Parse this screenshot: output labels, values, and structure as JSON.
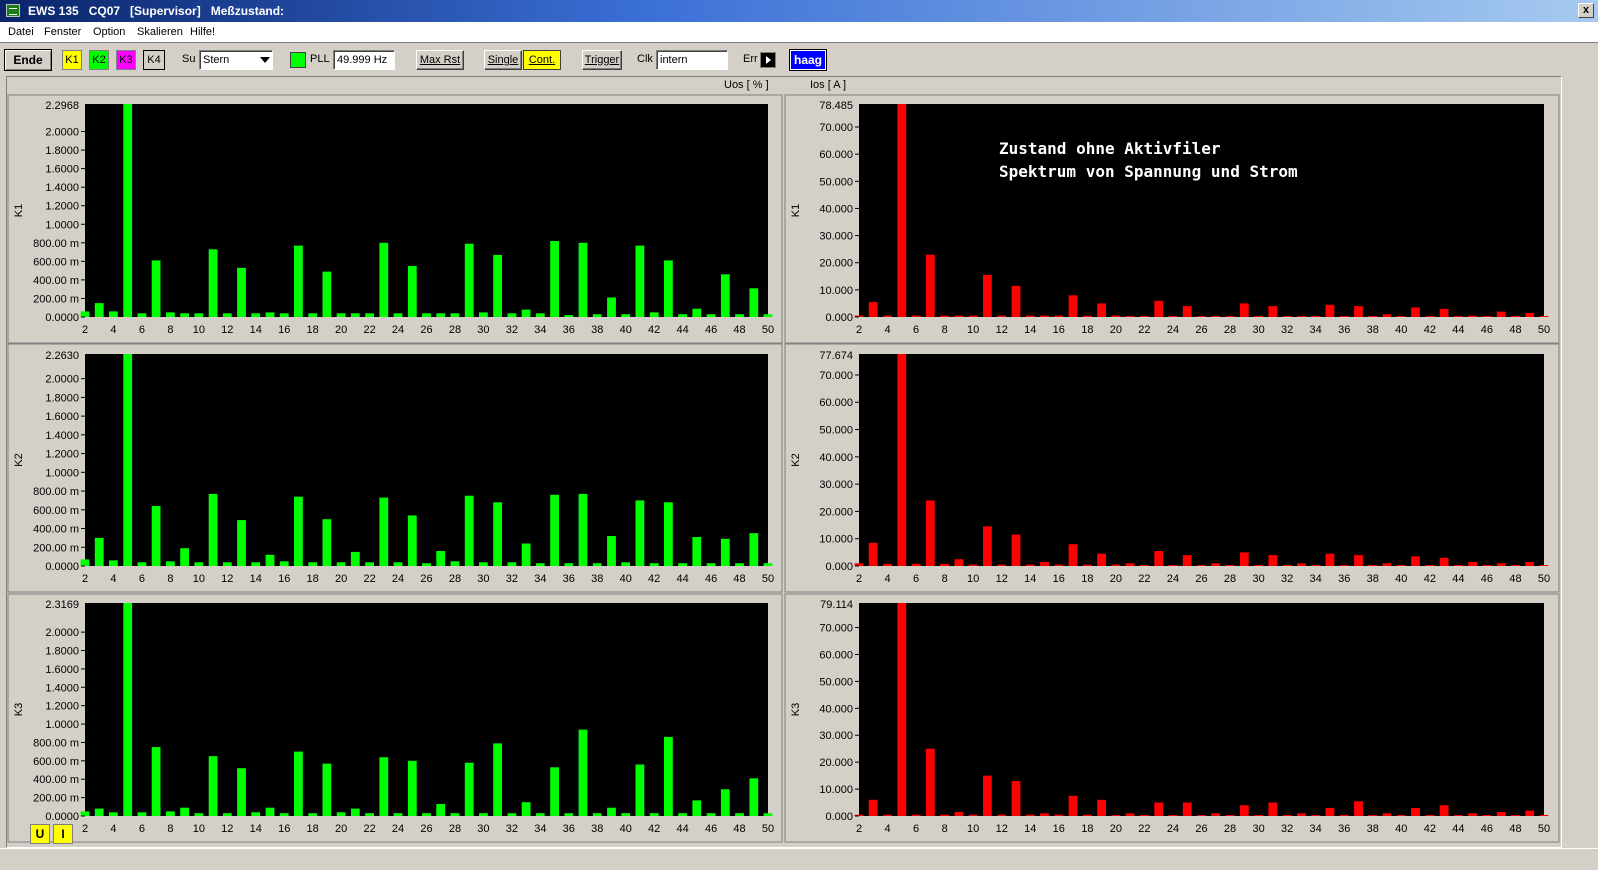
{
  "window": {
    "title": "EWS 135   CQ07   [Supervisor]   Meßzustand:",
    "close_label": "x"
  },
  "menu": [
    "Datei",
    "Fenster",
    "Option",
    "Skalieren",
    "Hilfe!"
  ],
  "toolbar": {
    "ende": "Ende",
    "k1": "K1",
    "k2": "K2",
    "k3": "K3",
    "k4": "K4",
    "su_label": "Su",
    "su_value": "Stern",
    "pll_label": "PLL",
    "pll_value": "49.999 Hz",
    "maxrst": "Max Rst",
    "single": "Single",
    "cont": "Cont.",
    "trigger": "Trigger",
    "clk_label": "Clk",
    "clk_value": "intern",
    "err_label": "Err",
    "logo": "haag"
  },
  "headers": {
    "left": "Uos [ % ]",
    "right": "Ios [ A ]"
  },
  "annotation": [
    "Zustand ohne Aktivfiler",
    "Spektrum von Spannung und Strom"
  ],
  "bottom_buttons": {
    "u": "U",
    "i": "I"
  },
  "colors": {
    "voltage": "#00ff00",
    "current": "#ff0000",
    "plot_bg": "#000000",
    "k1": "#ffff00",
    "k2": "#00ff00",
    "k3": "#ff00ff"
  },
  "chart_data": [
    {
      "type": "bar",
      "name": "K1",
      "quantity": "Uos",
      "xlabel": "",
      "ylabel": "K1",
      "x": [
        2,
        3,
        4,
        5,
        6,
        7,
        8,
        9,
        10,
        11,
        12,
        13,
        14,
        15,
        16,
        17,
        18,
        19,
        20,
        21,
        22,
        23,
        24,
        25,
        26,
        27,
        28,
        29,
        30,
        31,
        32,
        33,
        34,
        35,
        36,
        37,
        38,
        39,
        40,
        41,
        42,
        43,
        44,
        45,
        46,
        47,
        48,
        49,
        50
      ],
      "values": [
        0.06,
        0.15,
        0.06,
        2.2968,
        0.04,
        0.61,
        0.05,
        0.04,
        0.04,
        0.73,
        0.04,
        0.53,
        0.04,
        0.05,
        0.04,
        0.77,
        0.04,
        0.49,
        0.04,
        0.04,
        0.04,
        0.8,
        0.04,
        0.55,
        0.04,
        0.04,
        0.04,
        0.79,
        0.05,
        0.67,
        0.04,
        0.08,
        0.04,
        0.82,
        0.02,
        0.8,
        0.03,
        0.21,
        0.03,
        0.77,
        0.05,
        0.61,
        0.03,
        0.09,
        0.03,
        0.46,
        0.03,
        0.31,
        0.03
      ],
      "yticks": [
        "0.0000",
        "200.00 m",
        "400.00 m",
        "600.00 m",
        "800.00 m",
        "1.0000",
        "1.2000",
        "1.4000",
        "1.6000",
        "1.8000",
        "2.0000"
      ],
      "ymax_label": "2.2968",
      "ylim": [
        0,
        2.2968
      ],
      "xticks": [
        2,
        4,
        6,
        8,
        10,
        12,
        14,
        16,
        18,
        20,
        22,
        24,
        26,
        28,
        30,
        32,
        34,
        36,
        38,
        40,
        42,
        44,
        46,
        48,
        50
      ]
    },
    {
      "type": "bar",
      "name": "K1",
      "quantity": "Ios",
      "xlabel": "",
      "ylabel": "K1",
      "x": [
        2,
        3,
        4,
        5,
        6,
        7,
        8,
        9,
        10,
        11,
        12,
        13,
        14,
        15,
        16,
        17,
        18,
        19,
        20,
        21,
        22,
        23,
        24,
        25,
        26,
        27,
        28,
        29,
        30,
        31,
        32,
        33,
        34,
        35,
        36,
        37,
        38,
        39,
        40,
        41,
        42,
        43,
        44,
        45,
        46,
        47,
        48,
        49,
        50
      ],
      "values": [
        0.5,
        5.5,
        0.5,
        78.485,
        0.5,
        23,
        0.5,
        0.5,
        0.5,
        15.5,
        0.5,
        11.5,
        0.5,
        0.5,
        0.5,
        8,
        0.5,
        5,
        0.5,
        0.3,
        0.3,
        6,
        0.3,
        4,
        0.3,
        0.3,
        0.3,
        5,
        0.3,
        4,
        0.3,
        0.3,
        0.3,
        4.5,
        0.3,
        4,
        0.3,
        1,
        0.3,
        3.5,
        0.3,
        3,
        0.3,
        0.5,
        0.3,
        2,
        0.3,
        1.5,
        0.3
      ],
      "yticks": [
        "0.000",
        "10.000",
        "20.000",
        "30.000",
        "40.000",
        "50.000",
        "60.000",
        "70.000"
      ],
      "ymax_label": "78.485",
      "ylim": [
        0,
        78.485
      ],
      "xticks": [
        2,
        4,
        6,
        8,
        10,
        12,
        14,
        16,
        18,
        20,
        22,
        24,
        26,
        28,
        30,
        32,
        34,
        36,
        38,
        40,
        42,
        44,
        46,
        48,
        50
      ]
    },
    {
      "type": "bar",
      "name": "K2",
      "quantity": "Uos",
      "xlabel": "",
      "ylabel": "K2",
      "x": [
        2,
        3,
        4,
        5,
        6,
        7,
        8,
        9,
        10,
        11,
        12,
        13,
        14,
        15,
        16,
        17,
        18,
        19,
        20,
        21,
        22,
        23,
        24,
        25,
        26,
        27,
        28,
        29,
        30,
        31,
        32,
        33,
        34,
        35,
        36,
        37,
        38,
        39,
        40,
        41,
        42,
        43,
        44,
        45,
        46,
        47,
        48,
        49,
        50
      ],
      "values": [
        0.07,
        0.3,
        0.06,
        2.263,
        0.04,
        0.64,
        0.05,
        0.19,
        0.04,
        0.77,
        0.04,
        0.49,
        0.04,
        0.12,
        0.05,
        0.74,
        0.04,
        0.5,
        0.04,
        0.15,
        0.04,
        0.73,
        0.04,
        0.54,
        0.03,
        0.16,
        0.05,
        0.75,
        0.04,
        0.68,
        0.04,
        0.24,
        0.03,
        0.76,
        0.03,
        0.77,
        0.03,
        0.32,
        0.04,
        0.7,
        0.03,
        0.68,
        0.03,
        0.31,
        0.03,
        0.29,
        0.03,
        0.35,
        0.03
      ],
      "yticks": [
        "0.0000",
        "200.00 m",
        "400.00 m",
        "600.00 m",
        "800.00 m",
        "1.0000",
        "1.2000",
        "1.4000",
        "1.6000",
        "1.8000",
        "2.0000"
      ],
      "ymax_label": "2.2630",
      "ylim": [
        0,
        2.263
      ],
      "xticks": [
        2,
        4,
        6,
        8,
        10,
        12,
        14,
        16,
        18,
        20,
        22,
        24,
        26,
        28,
        30,
        32,
        34,
        36,
        38,
        40,
        42,
        44,
        46,
        48,
        50
      ]
    },
    {
      "type": "bar",
      "name": "K2",
      "quantity": "Ios",
      "xlabel": "",
      "ylabel": "K2",
      "x": [
        2,
        3,
        4,
        5,
        6,
        7,
        8,
        9,
        10,
        11,
        12,
        13,
        14,
        15,
        16,
        17,
        18,
        19,
        20,
        21,
        22,
        23,
        24,
        25,
        26,
        27,
        28,
        29,
        30,
        31,
        32,
        33,
        34,
        35,
        36,
        37,
        38,
        39,
        40,
        41,
        42,
        43,
        44,
        45,
        46,
        47,
        48,
        49,
        50
      ],
      "values": [
        1,
        8.5,
        0.8,
        77.674,
        0.8,
        24,
        0.8,
        2.5,
        0.5,
        14.5,
        0.5,
        11.5,
        0.5,
        1.5,
        0.5,
        8,
        0.5,
        4.5,
        0.5,
        1,
        0.3,
        5.5,
        0.3,
        4,
        0.3,
        1,
        0.3,
        5,
        0.3,
        4,
        0.3,
        1,
        0.3,
        4.5,
        0.3,
        4,
        0.3,
        1,
        0.3,
        3.5,
        0.3,
        3,
        0.3,
        1.5,
        0.3,
        1,
        0.3,
        1.5,
        0.3
      ],
      "yticks": [
        "0.000",
        "10.000",
        "20.000",
        "30.000",
        "40.000",
        "50.000",
        "60.000",
        "70.000"
      ],
      "ymax_label": "77.674",
      "ylim": [
        0,
        77.674
      ],
      "xticks": [
        2,
        4,
        6,
        8,
        10,
        12,
        14,
        16,
        18,
        20,
        22,
        24,
        26,
        28,
        30,
        32,
        34,
        36,
        38,
        40,
        42,
        44,
        46,
        48,
        50
      ]
    },
    {
      "type": "bar",
      "name": "K3",
      "quantity": "Uos",
      "xlabel": "",
      "ylabel": "K3",
      "x": [
        2,
        3,
        4,
        5,
        6,
        7,
        8,
        9,
        10,
        11,
        12,
        13,
        14,
        15,
        16,
        17,
        18,
        19,
        20,
        21,
        22,
        23,
        24,
        25,
        26,
        27,
        28,
        29,
        30,
        31,
        32,
        33,
        34,
        35,
        36,
        37,
        38,
        39,
        40,
        41,
        42,
        43,
        44,
        45,
        46,
        47,
        48,
        49,
        50
      ],
      "values": [
        0.05,
        0.08,
        0.04,
        2.3169,
        0.04,
        0.75,
        0.05,
        0.09,
        0.03,
        0.65,
        0.03,
        0.52,
        0.04,
        0.09,
        0.03,
        0.7,
        0.03,
        0.57,
        0.04,
        0.08,
        0.03,
        0.64,
        0.03,
        0.6,
        0.03,
        0.13,
        0.03,
        0.58,
        0.03,
        0.79,
        0.03,
        0.15,
        0.03,
        0.53,
        0.03,
        0.94,
        0.03,
        0.09,
        0.03,
        0.56,
        0.03,
        0.86,
        0.03,
        0.17,
        0.03,
        0.29,
        0.03,
        0.41,
        0.03
      ],
      "yticks": [
        "0.0000",
        "200.00 m",
        "400.00 m",
        "600.00 m",
        "800.00 m",
        "1.0000",
        "1.2000",
        "1.4000",
        "1.6000",
        "1.8000",
        "2.0000"
      ],
      "ymax_label": "2.3169",
      "ylim": [
        0,
        2.3169
      ],
      "xticks": [
        2,
        4,
        6,
        8,
        10,
        12,
        14,
        16,
        18,
        20,
        22,
        24,
        26,
        28,
        30,
        32,
        34,
        36,
        38,
        40,
        42,
        44,
        46,
        48,
        50
      ]
    },
    {
      "type": "bar",
      "name": "K3",
      "quantity": "Ios",
      "xlabel": "",
      "ylabel": "K3",
      "x": [
        2,
        3,
        4,
        5,
        6,
        7,
        8,
        9,
        10,
        11,
        12,
        13,
        14,
        15,
        16,
        17,
        18,
        19,
        20,
        21,
        22,
        23,
        24,
        25,
        26,
        27,
        28,
        29,
        30,
        31,
        32,
        33,
        34,
        35,
        36,
        37,
        38,
        39,
        40,
        41,
        42,
        43,
        44,
        45,
        46,
        47,
        48,
        49,
        50
      ],
      "values": [
        0.5,
        6,
        0.5,
        79.114,
        0.5,
        25,
        0.5,
        1.5,
        0.5,
        15,
        0.5,
        13,
        0.5,
        1,
        0.5,
        7.5,
        0.5,
        6,
        0.3,
        1,
        0.3,
        5,
        0.3,
        5,
        0.3,
        1,
        0.3,
        4,
        0.3,
        5,
        0.3,
        1,
        0.3,
        3,
        0.3,
        5.5,
        0.3,
        1,
        0.3,
        3,
        0.3,
        4,
        0.3,
        1,
        0.3,
        1.5,
        0.3,
        2,
        0.3
      ],
      "yticks": [
        "0.000",
        "10.000",
        "20.000",
        "30.000",
        "40.000",
        "50.000",
        "60.000",
        "70.000"
      ],
      "ymax_label": "79.114",
      "ylim": [
        0,
        79.114
      ],
      "xticks": [
        2,
        4,
        6,
        8,
        10,
        12,
        14,
        16,
        18,
        20,
        22,
        24,
        26,
        28,
        30,
        32,
        34,
        36,
        38,
        40,
        42,
        44,
        46,
        48,
        50
      ]
    }
  ]
}
